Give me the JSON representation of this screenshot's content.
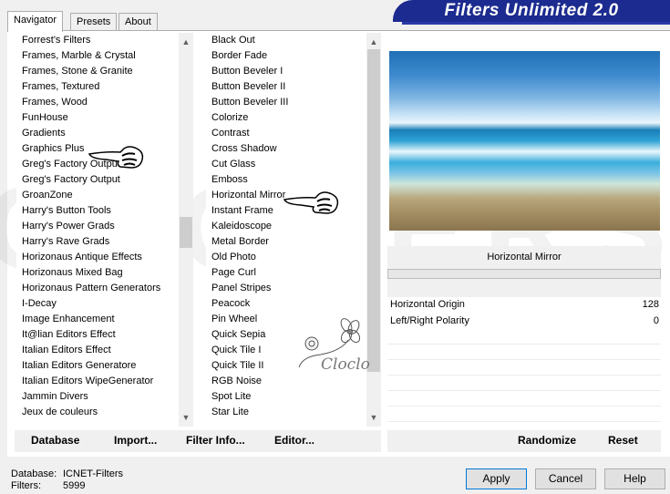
{
  "title": "Filters Unlimited 2.0",
  "tabs": [
    {
      "label": "Navigator",
      "active": true
    },
    {
      "label": "Presets",
      "active": false
    },
    {
      "label": "About",
      "active": false
    }
  ],
  "categories": [
    "Forrest's Filters",
    "Frames, Marble & Crystal",
    "Frames, Stone & Granite",
    "Frames, Textured",
    "Frames, Wood",
    "FunHouse",
    "Gradients",
    "Graphics Plus",
    "Greg's Factory Output",
    "Greg's Factory Output",
    "GroanZone",
    "Harry's Button Tools",
    "Harry's Power Grads",
    "Harry's Rave Grads",
    "Horizonaus Antique Effects",
    "Horizonaus Mixed Bag",
    "Horizonaus Pattern Generators",
    "I-Decay",
    "Image Enhancement",
    "It@lian Editors Effect",
    "Italian Editors Effect",
    "Italian Editors Generatore",
    "Italian Editors WipeGenerator",
    "Jammin Divers",
    "Jeux de couleurs"
  ],
  "filters": [
    "Black Out",
    "Border Fade",
    "Button Beveler I",
    "Button Beveler II",
    "Button Beveler III",
    "Colorize",
    "Contrast",
    "Cross Shadow",
    "Cut Glass",
    "Emboss",
    "Horizontal Mirror",
    "Instant Frame",
    "Kaleidoscope",
    "Metal Border",
    "Old Photo",
    "Page Curl",
    "Panel Stripes",
    "Peacock",
    "Pin Wheel",
    "Quick Sepia",
    "Quick Tile I",
    "Quick Tile II",
    "RGB Noise",
    "Spot Lite",
    "Star Lite"
  ],
  "selected_filter": "Horizontal Mirror",
  "params": [
    {
      "label": "Horizontal Origin",
      "value": "128"
    },
    {
      "label": "Left/Right Polarity",
      "value": "0"
    }
  ],
  "toolbar": {
    "database": "Database",
    "import": "Import...",
    "filter_info": "Filter Info...",
    "editor": "Editor...",
    "randomize": "Randomize",
    "reset": "Reset"
  },
  "status": {
    "database_label": "Database:",
    "database_value": "ICNET-Filters",
    "filters_label": "Filters:",
    "filters_value": "5999"
  },
  "buttons": {
    "apply": "Apply",
    "cancel": "Cancel",
    "help": "Help"
  },
  "watermark": "CLOVERS",
  "logo_text": "Cloclo",
  "colors": {
    "banner": "#1b2b8f",
    "focus": "#0078d7"
  }
}
